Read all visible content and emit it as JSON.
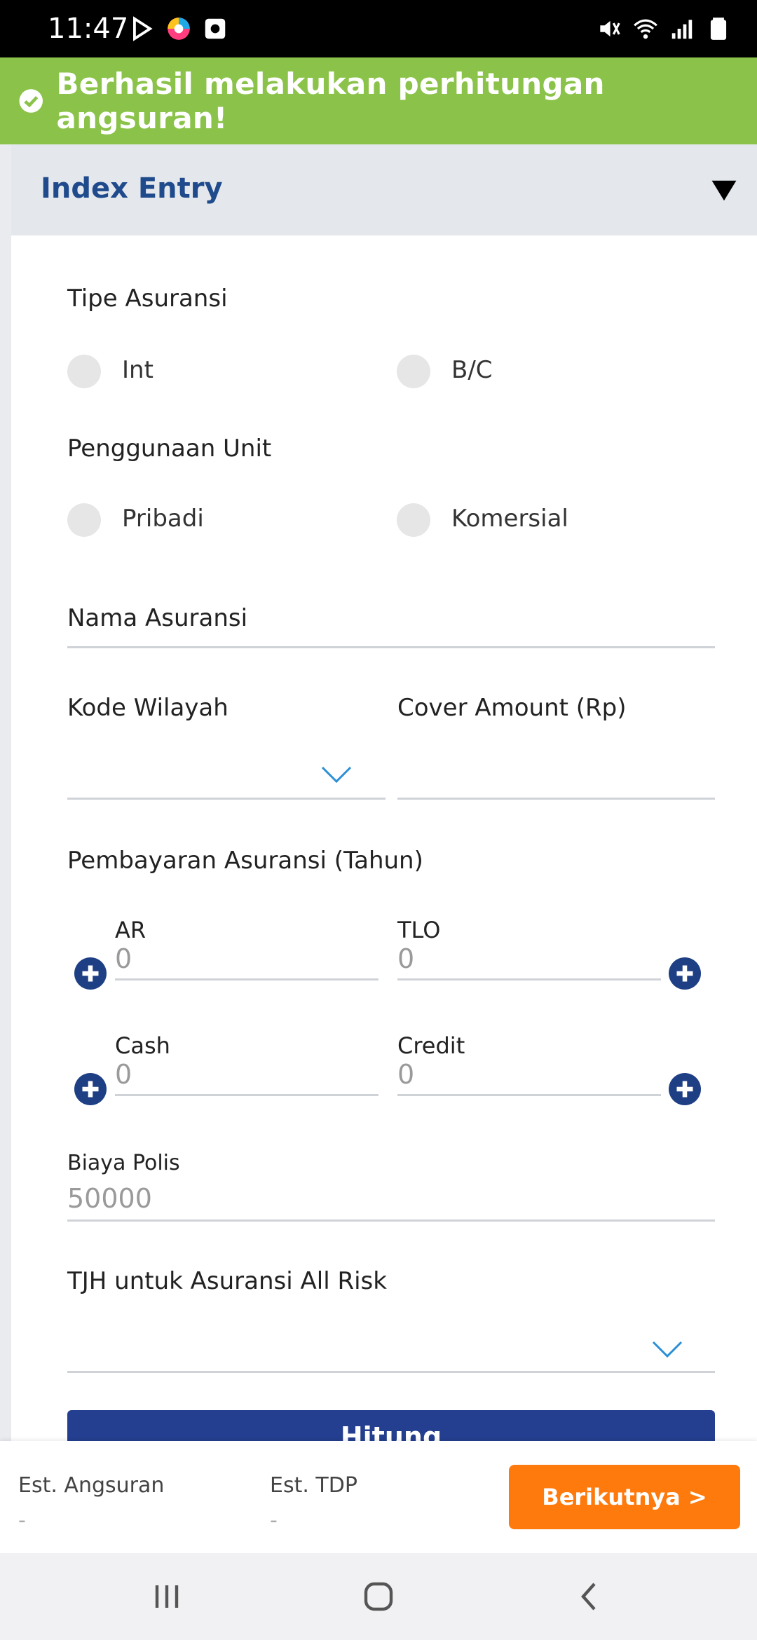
{
  "status_bar": {
    "time": "11:47"
  },
  "toast": {
    "message": "Berhasil melakukan perhitungan angsuran!"
  },
  "section": {
    "title": "Index Entry"
  },
  "form": {
    "tipe_asuransi": {
      "label": "Tipe Asuransi",
      "options": [
        "Int",
        "B/C"
      ]
    },
    "penggunaan_unit": {
      "label": "Penggunaan Unit",
      "options": [
        "Pribadi",
        "Komersial"
      ]
    },
    "nama_asuransi": {
      "label": "Nama Asuransi",
      "value": ""
    },
    "kode_wilayah": {
      "label": "Kode Wilayah",
      "value": ""
    },
    "cover_amount": {
      "label": "Cover Amount (Rp)",
      "value": ""
    },
    "pembayaran": {
      "label": "Pembayaran Asuransi (Tahun)",
      "ar": {
        "label": "AR",
        "value": "0"
      },
      "tlo": {
        "label": "TLO",
        "value": "0"
      },
      "cash": {
        "label": "Cash",
        "value": "0"
      },
      "credit": {
        "label": "Credit",
        "value": "0"
      }
    },
    "biaya_polis": {
      "label": "Biaya Polis",
      "value": "50000"
    },
    "tjh": {
      "label": "TJH untuk Asuransi All Risk",
      "value": ""
    },
    "hitung_label": "Hitung"
  },
  "bottom": {
    "est_angsuran_label": "Est. Angsuran",
    "est_angsuran_value": "-",
    "est_tdp_label": "Est. TDP",
    "est_tdp_value": "-",
    "next_label": "Berikutnya >"
  },
  "colors": {
    "toast": "#8bc34a",
    "primary": "#243f8f",
    "accent": "#ff7a0c",
    "title": "#1f4a8c"
  }
}
